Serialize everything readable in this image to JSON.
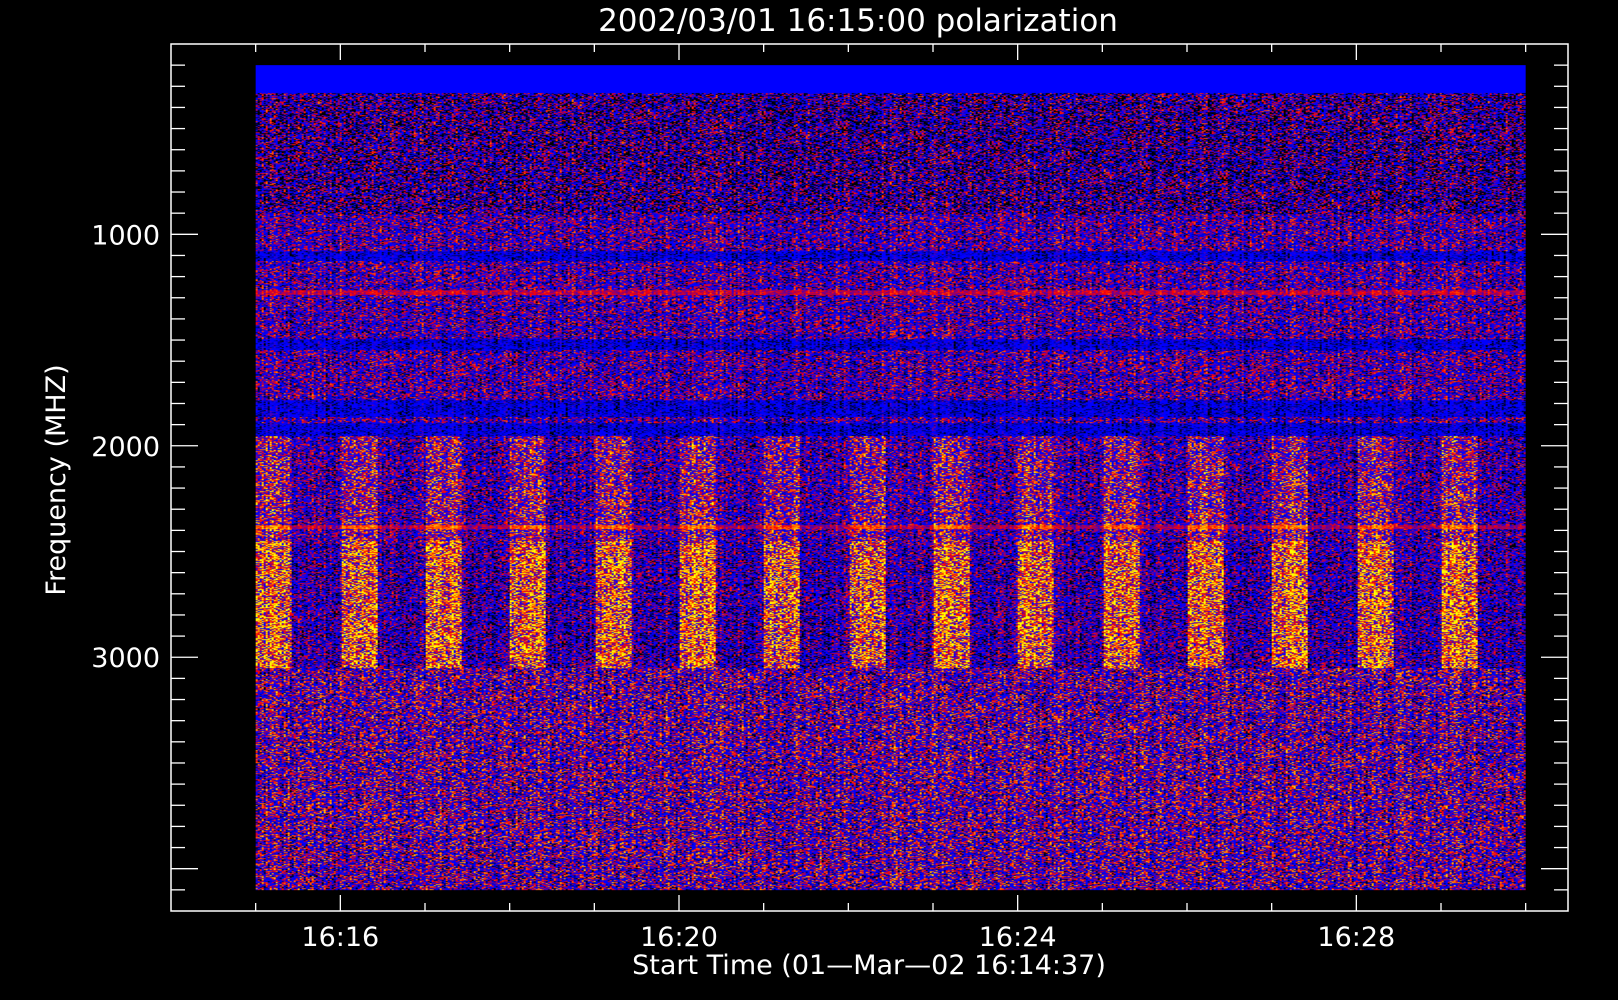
{
  "chart_data": {
    "type": "heatmap",
    "title": "2002/03/01 16:15:00 polarization",
    "xlabel": "Start Time (01—Mar—02 16:14:37)",
    "ylabel": "Frequency (MHZ)",
    "x_tick_labels": [
      "16:16",
      "16:20",
      "16:24",
      "16:28"
    ],
    "x_tick_minutes": [
      16,
      20,
      24,
      28
    ],
    "x_minor_minutes": [
      15,
      17,
      18,
      19,
      21,
      22,
      23,
      25,
      26,
      27,
      29,
      30
    ],
    "x_range_minutes": [
      14.0,
      30.5
    ],
    "y_tick_labels": [
      "1000",
      "2000",
      "3000"
    ],
    "y_tick_values": [
      1000,
      2000,
      3000
    ],
    "y_range": [
      100,
      4200
    ],
    "y_inverted": true,
    "data_x_range_minutes": [
      15.0,
      30.0
    ],
    "data_y_range": [
      200,
      4100
    ],
    "burst_period_minutes": 1.0,
    "colors": {
      "background": "#000000",
      "axes": "#ffffff",
      "low": "#0000ff",
      "mid": "#ff0000",
      "high": "#ffff00"
    }
  }
}
